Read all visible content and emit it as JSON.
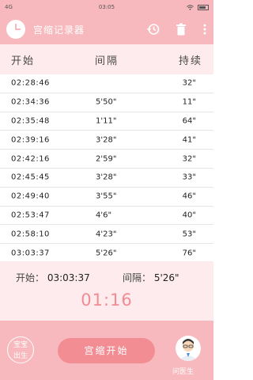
{
  "status_bar": {
    "network": "4G",
    "time": "03:05"
  },
  "app_bar": {
    "title": "宫缩记录器",
    "icons": [
      "clock-logo-icon",
      "history-icon",
      "trash-icon",
      "more-vertical-icon"
    ]
  },
  "columns": {
    "start": "开始",
    "interval": "间隔",
    "duration": "持续"
  },
  "records": [
    {
      "start": "02:28:46",
      "interval": "",
      "duration": "32\""
    },
    {
      "start": "02:34:36",
      "interval": "5'50\"",
      "duration": "11\""
    },
    {
      "start": "02:35:48",
      "interval": "1'11\"",
      "duration": "64\""
    },
    {
      "start": "02:39:16",
      "interval": "3'28\"",
      "duration": "41\""
    },
    {
      "start": "02:42:16",
      "interval": "2'59\"",
      "duration": "32\""
    },
    {
      "start": "02:45:45",
      "interval": "3'28\"",
      "duration": "33\""
    },
    {
      "start": "02:49:40",
      "interval": "3'55\"",
      "duration": "46\""
    },
    {
      "start": "02:53:47",
      "interval": "4'6\"",
      "duration": "40\""
    },
    {
      "start": "02:58:10",
      "interval": "4'23\"",
      "duration": "53\""
    },
    {
      "start": "03:03:37",
      "interval": "5'26\"",
      "duration": "76\""
    }
  ],
  "summary": {
    "start_label": "开始：",
    "start_value": "03:03:37",
    "interval_label": "间隔：",
    "interval_value": "5'26\"",
    "timer": "01:16"
  },
  "bottom_bar": {
    "baby_button_line1": "宝宝",
    "baby_button_line2": "出生",
    "start_button": "宫缩开始",
    "doctor_label": "问医生"
  },
  "colors": {
    "primary": "#f7b9bd",
    "accent": "#f38d94",
    "light": "#fdebed",
    "timer": "#f28b93"
  }
}
